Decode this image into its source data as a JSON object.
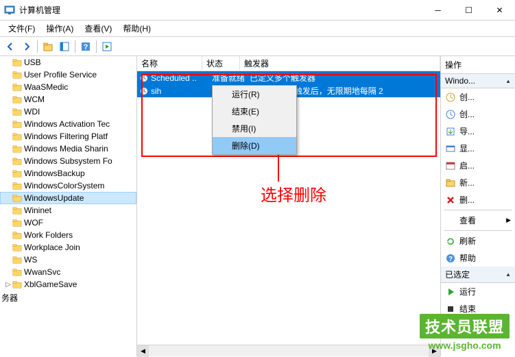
{
  "window": {
    "title": "计算机管理"
  },
  "menubar": {
    "file": "文件(F)",
    "action": "操作(A)",
    "view": "查看(V)",
    "help": "帮助(H)"
  },
  "tree": {
    "items": [
      {
        "label": "USB",
        "indent": 1
      },
      {
        "label": "User Profile Service",
        "indent": 1
      },
      {
        "label": "WaaSMedic",
        "indent": 1
      },
      {
        "label": "WCM",
        "indent": 1
      },
      {
        "label": "WDI",
        "indent": 1
      },
      {
        "label": "Windows Activation Tec",
        "indent": 1
      },
      {
        "label": "Windows Filtering Platf",
        "indent": 1
      },
      {
        "label": "Windows Media Sharin",
        "indent": 1
      },
      {
        "label": "Windows Subsystem Fo",
        "indent": 1
      },
      {
        "label": "WindowsBackup",
        "indent": 1
      },
      {
        "label": "WindowsColorSystem",
        "indent": 1
      },
      {
        "label": "WindowsUpdate",
        "indent": 1,
        "selected": true
      },
      {
        "label": "Wininet",
        "indent": 1
      },
      {
        "label": "WOF",
        "indent": 1
      },
      {
        "label": "Work Folders",
        "indent": 1
      },
      {
        "label": "Workplace Join",
        "indent": 1
      },
      {
        "label": "WS",
        "indent": 1
      },
      {
        "label": "WwanSvc",
        "indent": 1
      },
      {
        "label": "XblGameSave",
        "indent": 0,
        "expander": "▷"
      }
    ],
    "bottom_label": "务器"
  },
  "columns": {
    "name": "名称",
    "status": "状态",
    "trigger": "触发器"
  },
  "tasks": [
    {
      "name": "Scheduled ..",
      "status": "准备就绪",
      "trigger": "已定义多个触发器"
    },
    {
      "name": "sih",
      "status": "",
      "trigger": "                                    的 8:00 时 - 触发后，无限期地每隔 2"
    }
  ],
  "context_menu": {
    "run": "运行(R)",
    "end": "结束(E)",
    "disable": "禁用(I)",
    "delete": "删除(D)"
  },
  "annotation": {
    "text": "选择删除"
  },
  "actions": {
    "header": "操作",
    "section1": "Windo...",
    "items1": [
      {
        "label": "创...",
        "icon": "new-task"
      },
      {
        "label": "创...",
        "icon": "new-basic"
      },
      {
        "label": "导...",
        "icon": "import"
      },
      {
        "label": "显...",
        "icon": "show"
      },
      {
        "label": "启...",
        "icon": "enable"
      },
      {
        "label": "新...",
        "icon": "new-folder"
      },
      {
        "label": "删...",
        "icon": "delete-x"
      }
    ],
    "view": "查看",
    "items2": [
      {
        "label": "刷新",
        "icon": "refresh"
      },
      {
        "label": "帮助",
        "icon": "help"
      }
    ],
    "section2": "已选定",
    "items3": [
      {
        "label": "运行",
        "icon": "run"
      },
      {
        "label": "结束",
        "icon": "end"
      }
    ]
  },
  "watermark": {
    "main": "技术员联盟",
    "url": "www.jsgho.com"
  }
}
